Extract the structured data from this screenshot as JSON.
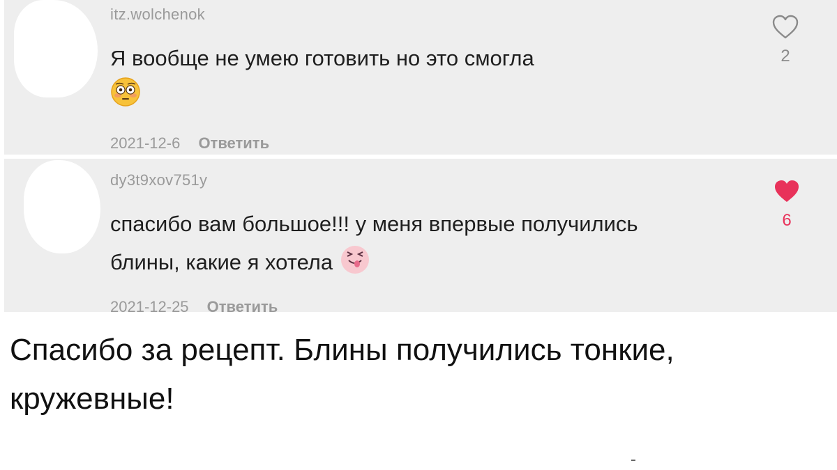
{
  "comments": [
    {
      "username": "itz.wolchenok",
      "text": "Я вообще не умею готовить но это смогла",
      "emoji": "flushed-face-emoji",
      "date": "2021-12-6",
      "reply_label": "Ответить",
      "likes": "2",
      "liked": false
    },
    {
      "username": "dy3t9xov751y",
      "text": "спасибо вам большое!!! у меня впервые получились блины, какие я хотела",
      "emoji": "pink-winking-tongue-face-emoji",
      "date": "2021-12-25",
      "reply_label": "Ответить",
      "likes": "6",
      "liked": true
    }
  ],
  "caption": "Спасибо за рецепт. Блины получились тонкие, кружевные!",
  "colors": {
    "comment_bg": "#eeeeee",
    "muted_text": "#9a9a9a",
    "liked_heart": "#e8325a"
  }
}
